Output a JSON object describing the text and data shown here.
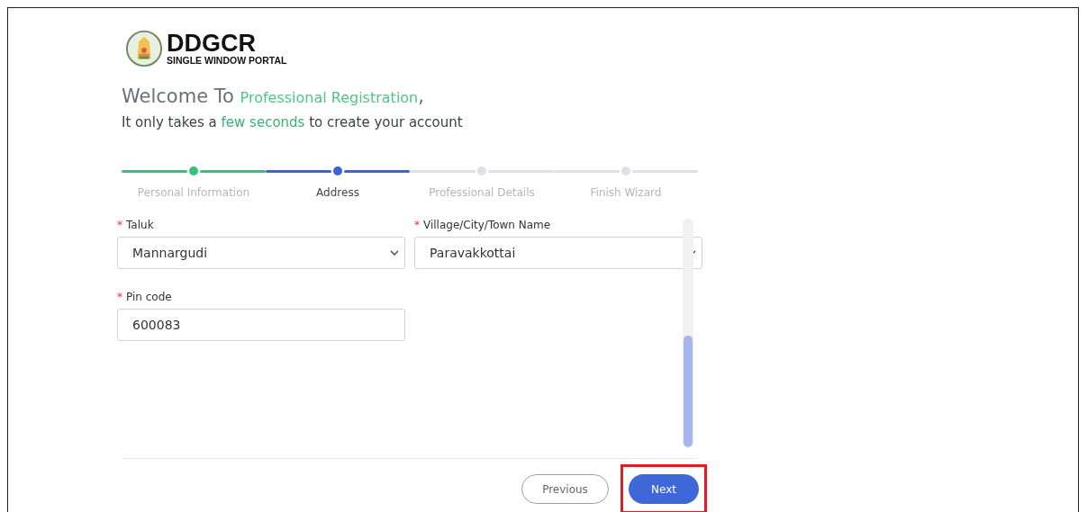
{
  "brand": {
    "name": "DDGCR",
    "tagline": "SINGLE WINDOW PORTAL"
  },
  "welcome": {
    "lead": "Welcome To",
    "highlight": "Professional Registration",
    "trail": ","
  },
  "subtitle": {
    "before": "It only takes a",
    "highlight": "few seconds",
    "after": "to create your account"
  },
  "steps": [
    {
      "label": "Personal Information",
      "completed": true,
      "selected": false
    },
    {
      "label": "Address",
      "completed": false,
      "selected": true
    },
    {
      "label": "Professional Details",
      "completed": false,
      "selected": false
    },
    {
      "label": "Finish Wizard",
      "completed": false,
      "selected": false
    }
  ],
  "fields": [
    {
      "label": "Taluk",
      "required_mark": "*",
      "kind": "select",
      "value": "Mannargudi"
    },
    {
      "label": "Village/City/Town Name",
      "required_mark": "*",
      "kind": "select",
      "value": "Paravakkottai"
    },
    {
      "label": "Pin code",
      "required_mark": "*",
      "kind": "text",
      "value": "600083"
    }
  ],
  "buttons": [
    {
      "label": "Previous",
      "kind": "secondary",
      "highlighted": false
    },
    {
      "label": "Next",
      "kind": "primary",
      "highlighted": true
    }
  ]
}
